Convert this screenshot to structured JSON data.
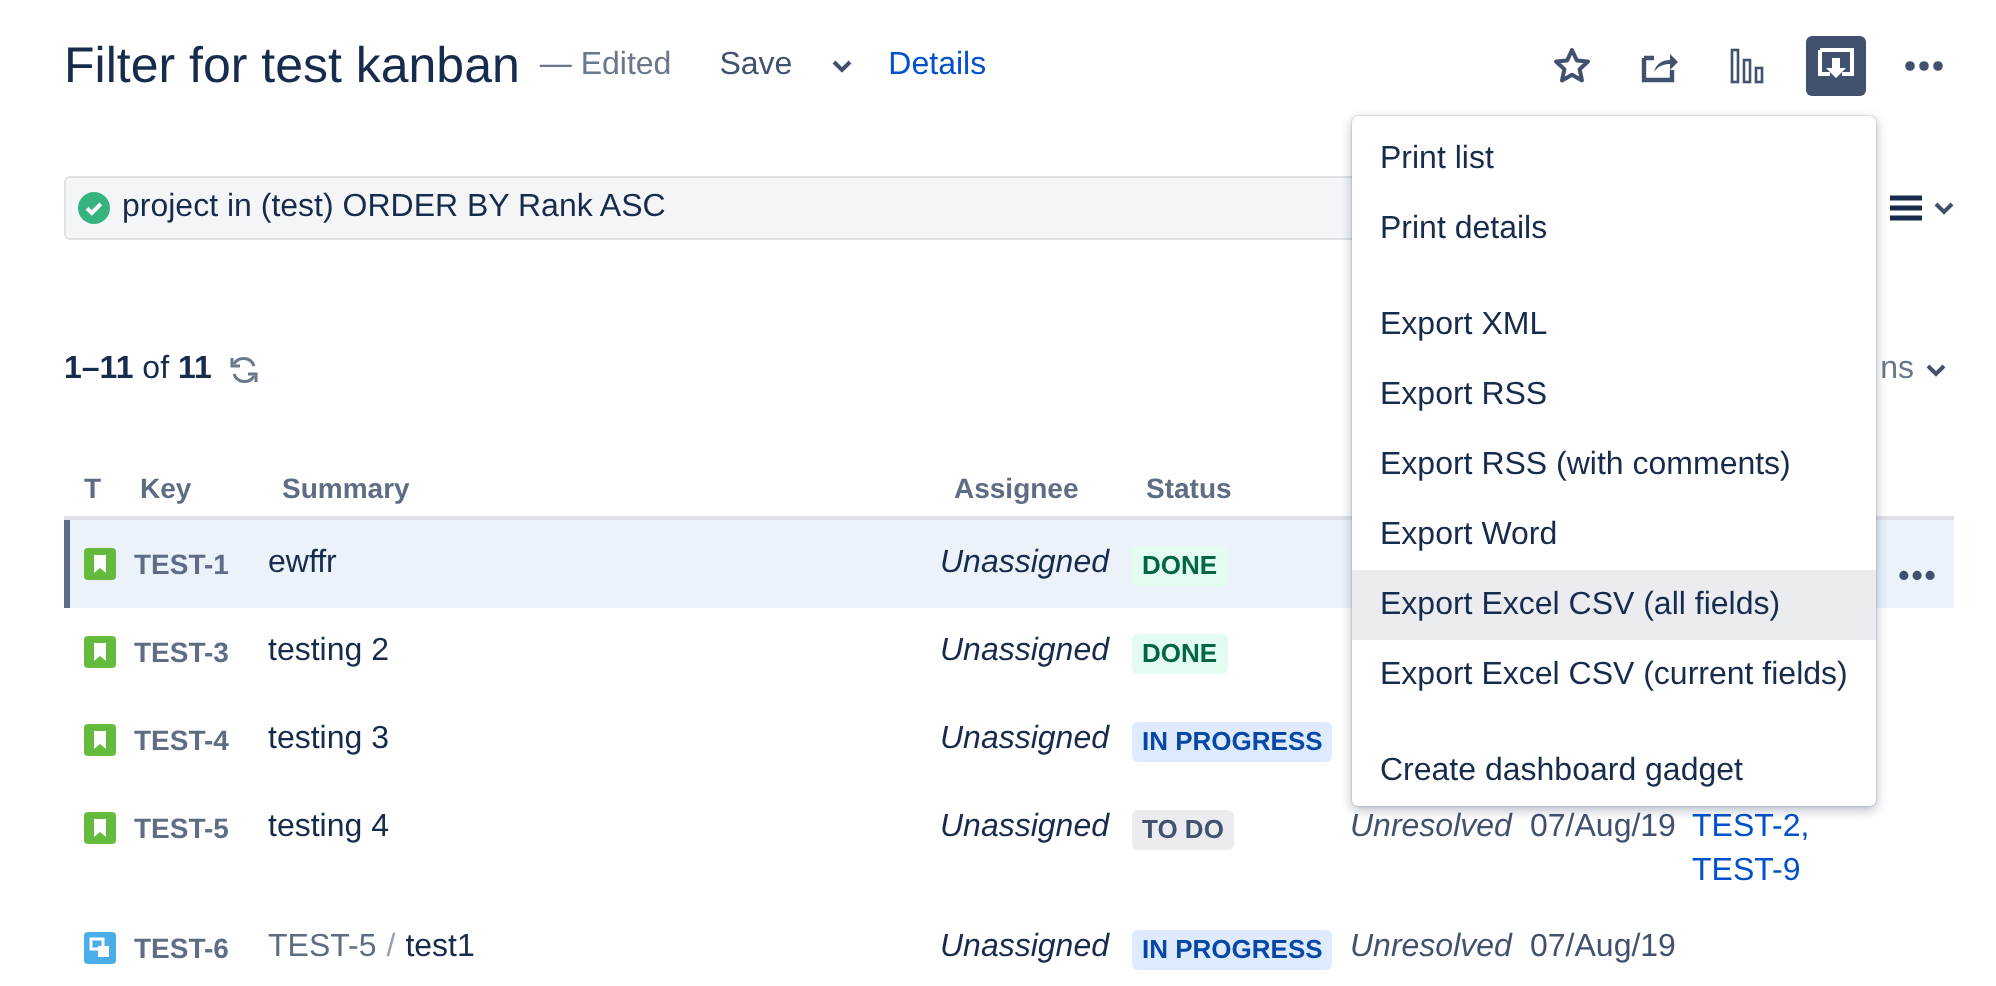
{
  "header": {
    "title": "Filter for test kanban",
    "edited": "— Edited",
    "save": "Save",
    "details": "Details"
  },
  "toolbar": [
    {
      "kind": "star",
      "active": false
    },
    {
      "kind": "share",
      "active": false
    },
    {
      "kind": "chart",
      "active": false
    },
    {
      "kind": "export",
      "active": true
    },
    {
      "kind": "more",
      "active": false
    }
  ],
  "query": {
    "valid": true,
    "value": "project in (test) ORDER BY Rank ASC"
  },
  "count": "**1–11** of **11**",
  "columns_button": {
    "label": "ns"
  },
  "table": {
    "columns": [
      "T",
      "Key",
      "Summary",
      "Assignee",
      "Status"
    ],
    "rows": [
      {
        "kind": "story",
        "key": "TEST-1",
        "summary": "ewffr",
        "assignee": "Unassigned",
        "status": {
          "label": "DONE",
          "kind": "done"
        },
        "selected": true,
        "actions": "•••"
      },
      {
        "kind": "story",
        "key": "TEST-3",
        "summary": "testing 2",
        "assignee": "Unassigned",
        "status": {
          "label": "DONE",
          "kind": "done"
        },
        "selected": false
      },
      {
        "kind": "story",
        "key": "TEST-4",
        "summary": "testing 3",
        "assignee": "Unassigned",
        "status": {
          "label": "IN PROGRESS",
          "kind": "progress"
        },
        "selected": false
      },
      {
        "kind": "story",
        "key": "TEST-5",
        "summary": "testing 4",
        "assignee": "Unassigned",
        "status": {
          "label": "TO DO",
          "kind": "todo"
        },
        "resolution": "Unresolved",
        "created": "07/Aug/19",
        "links": [
          "TEST-2,",
          "TEST-9"
        ],
        "selected": false
      },
      {
        "kind": "subtask",
        "key": "TEST-6",
        "parent": "TEST-5",
        "separator": "/",
        "summary": "test1",
        "assignee": "Unassigned",
        "status": {
          "label": "IN PROGRESS",
          "kind": "progress"
        },
        "resolution": "Unresolved",
        "created": "07/Aug/19",
        "selected": false
      }
    ]
  },
  "menu": {
    "groups": [
      [
        {
          "label": "Print list",
          "highlighted": false
        },
        {
          "label": "Print details",
          "highlighted": false
        }
      ],
      [
        {
          "label": "Export XML",
          "highlighted": false
        },
        {
          "label": "Export RSS",
          "highlighted": false
        },
        {
          "label": "Export RSS (with comments)",
          "highlighted": false
        },
        {
          "label": "Export Word",
          "highlighted": false
        },
        {
          "label": "Export Excel CSV (all fields)",
          "highlighted": true
        },
        {
          "label": "Export Excel CSV (current fields)",
          "highlighted": false
        }
      ],
      [
        {
          "label": "Create dashboard gadget",
          "highlighted": false
        }
      ]
    ]
  }
}
